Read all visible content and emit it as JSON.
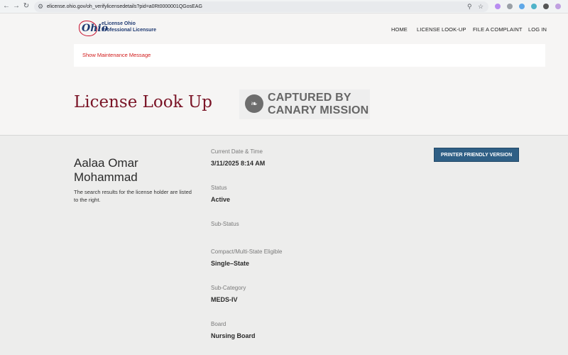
{
  "browser": {
    "url": "elicense.ohio.gov/oh_verifylicensedetails?pid=a0Rt0000001QGosEAG",
    "back_icon": "arrow-left-icon",
    "forward_icon": "arrow-right-icon",
    "reload_icon": "reload-icon"
  },
  "header": {
    "logo_text": "Ohio",
    "logo_line1": "eLicense Ohio",
    "logo_line2": "Professional Licensure",
    "nav": {
      "home": "HOME",
      "license_lookup": "LICENSE LOOK-UP",
      "file_complaint": "FILE A COMPLAINT",
      "login": "LOG IN"
    }
  },
  "maintenance": {
    "link": "Show Maintenance Message"
  },
  "page_title": "License Look Up",
  "watermark": {
    "line1": "CAPTURED BY",
    "line2": "CANARY MISSION"
  },
  "holder": {
    "name": "Aalaa  Omar  Mohammad",
    "description": "The search results for the license holder are listed to the right."
  },
  "details": {
    "current_datetime_label": "Current Date & Time",
    "current_datetime_value": "3/11/2025 8:14 AM",
    "status_label": "Status",
    "status_value": "Active",
    "substatus_label": "Sub-Status",
    "substatus_value": "",
    "compact_label": "Compact/Multi-State Eligible",
    "compact_value": "Single–State",
    "subcategory_label": "Sub-Category",
    "subcategory_value": "MEDS-IV",
    "board_label": "Board",
    "board_value": "Nursing Board"
  },
  "printer_button": "PRINTER FRIENDLY VERSION",
  "colors": {
    "title": "#7a1426",
    "button": "#2f5f85",
    "maintenance_link": "#d11a1a",
    "brand_blue": "#1f3a72"
  }
}
